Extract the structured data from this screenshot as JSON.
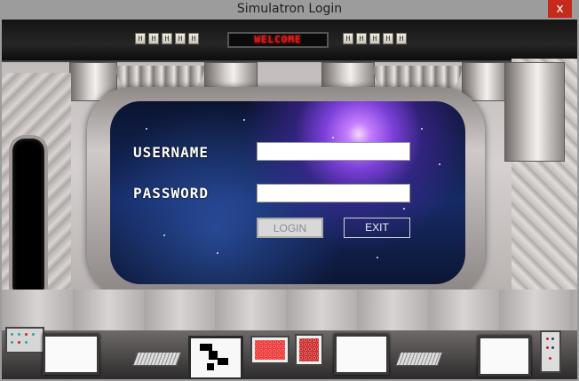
{
  "window": {
    "title": "Simulatron Login",
    "close_glyph": "x"
  },
  "display": {
    "marquee": "WELCOME"
  },
  "top_panel": {
    "left_keys": [
      "H",
      "H",
      "H",
      "H",
      "H"
    ],
    "right_keys": [
      "H",
      "H",
      "H",
      "H",
      "H"
    ]
  },
  "form": {
    "username_label": "USERNAME",
    "password_label": "PASSWORD",
    "username_value": "",
    "password_value": "",
    "login_label": "LOGIN",
    "exit_label": "EXIT"
  },
  "colors": {
    "marquee_text": "#e01818",
    "close_button": "#c42b1c",
    "login_disabled_text": "#8d8d8d"
  },
  "icons": [
    "close-icon"
  ]
}
